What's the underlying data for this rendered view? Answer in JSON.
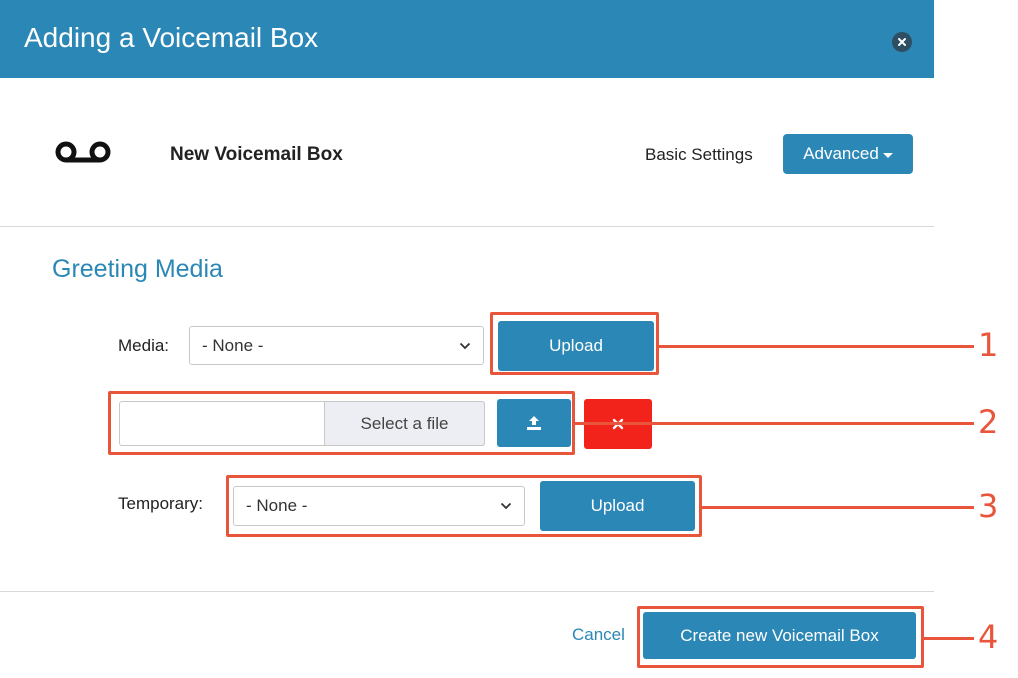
{
  "dialog": {
    "title": "Adding a Voicemail Box",
    "close_icon": "close-circle-icon"
  },
  "header": {
    "icon": "voicemail-icon",
    "box_name": "New Voicemail Box",
    "basic_settings_label": "Basic Settings",
    "advanced_label": "Advanced"
  },
  "section": {
    "heading": "Greeting Media"
  },
  "media": {
    "label": "Media:",
    "selected": "- None -",
    "upload_label": "Upload"
  },
  "file": {
    "input_value": "",
    "select_label": "Select a file",
    "upload_icon": "upload-icon",
    "remove_icon": "remove-x-icon"
  },
  "temporary": {
    "label": "Temporary:",
    "selected": "- None -",
    "upload_label": "Upload"
  },
  "footer": {
    "cancel_label": "Cancel",
    "create_label": "Create new Voicemail Box"
  },
  "callouts": [
    "1",
    "2",
    "3",
    "4"
  ],
  "colors": {
    "primary": "#2b87b5",
    "danger": "#f2231a",
    "annotation": "#e8553a",
    "close_button": "#2d4e63"
  }
}
